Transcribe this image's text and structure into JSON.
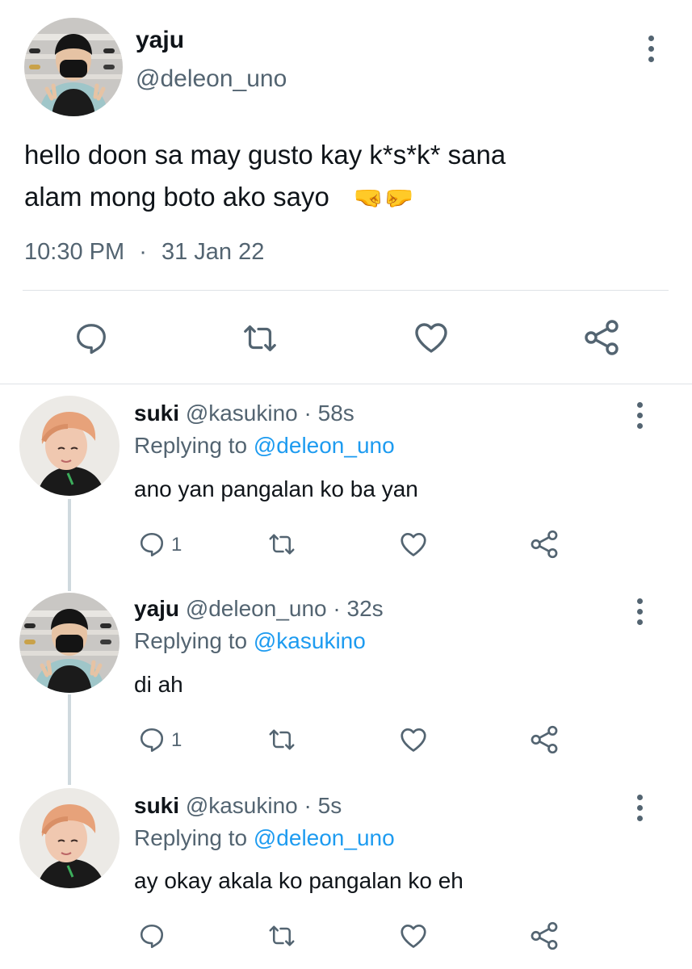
{
  "main_tweet": {
    "name": "yaju",
    "handle": "@deleon_uno",
    "text_line1": "hello doon sa may gusto kay k*s*k* sana",
    "text_line2": "alam mong boto ako sayo",
    "emoji": "🤜🤛",
    "time": "10:30 PM",
    "separator": "·",
    "date": "31 Jan 22"
  },
  "replies": [
    {
      "name": "suki",
      "handle": "@kasukino",
      "sep": "·",
      "time": "58s",
      "replying_label": "Replying to",
      "replying_to": "@deleon_uno",
      "text": "ano yan pangalan ko ba yan",
      "reply_count": "1"
    },
    {
      "name": "yaju",
      "handle": "@deleon_uno",
      "sep": "·",
      "time": "32s",
      "replying_label": "Replying to",
      "replying_to": "@kasukino",
      "text": "di ah",
      "reply_count": "1"
    },
    {
      "name": "suki",
      "handle": "@kasukino",
      "sep": "·",
      "time": "5s",
      "replying_label": "Replying to",
      "replying_to": "@deleon_uno",
      "text": "ay okay akala ko pangalan ko eh",
      "reply_count": ""
    }
  ],
  "icons": {
    "reply": "reply-icon",
    "retweet": "retweet-icon",
    "like": "heart-icon",
    "share": "share-icon",
    "more": "more-vertical-icon"
  },
  "colors": {
    "text": "#0f1419",
    "secondary": "#536471",
    "link": "#1d9bf0",
    "divider": "#dfe3e6"
  }
}
